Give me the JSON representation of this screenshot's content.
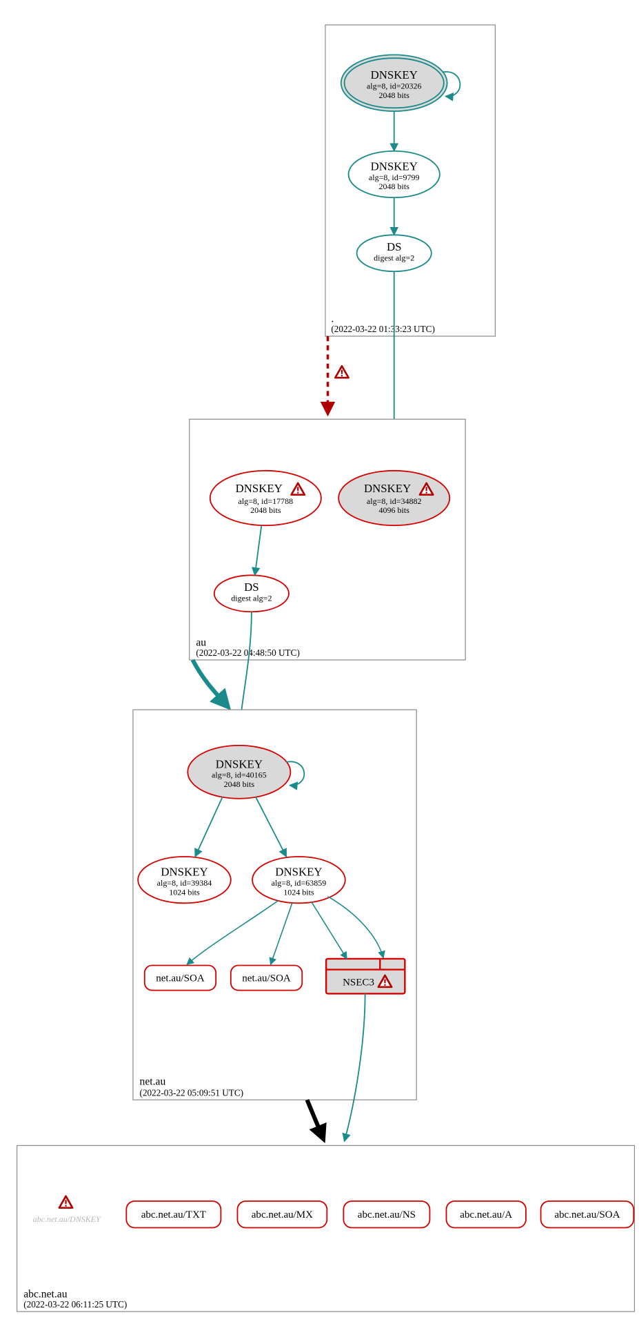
{
  "colors": {
    "teal": "#1a8a8a",
    "red": "#d40000",
    "darkred": "#b00000",
    "greyfill": "#d9d9d9",
    "lightgrey": "#f0f0f0",
    "boxstroke": "#8a8a8a",
    "faded": "#b8b8b8",
    "black": "#000000"
  },
  "zones": {
    "root": {
      "name": ".",
      "ts": "(2022-03-22 01:33:23 UTC)"
    },
    "au": {
      "name": "au",
      "ts": "(2022-03-22 04:48:50 UTC)"
    },
    "netau": {
      "name": "net.au",
      "ts": "(2022-03-22 05:09:51 UTC)"
    },
    "abc": {
      "name": "abc.net.au",
      "ts": "(2022-03-22 06:11:25 UTC)"
    }
  },
  "nodes": {
    "root_ksk": {
      "title": "DNSKEY",
      "l1": "alg=8, id=20326",
      "l2": "2048 bits"
    },
    "root_zsk": {
      "title": "DNSKEY",
      "l1": "alg=8, id=9799",
      "l2": "2048 bits"
    },
    "root_ds": {
      "title": "DS",
      "l1": "digest alg=2"
    },
    "au_k1": {
      "title": "DNSKEY",
      "l1": "alg=8, id=17788",
      "l2": "2048 bits"
    },
    "au_k2": {
      "title": "DNSKEY",
      "l1": "alg=8, id=34882",
      "l2": "4096 bits"
    },
    "au_ds": {
      "title": "DS",
      "l1": "digest alg=2"
    },
    "netau_ksk": {
      "title": "DNSKEY",
      "l1": "alg=8, id=40165",
      "l2": "2048 bits"
    },
    "netau_z1": {
      "title": "DNSKEY",
      "l1": "alg=8, id=39384",
      "l2": "1024 bits"
    },
    "netau_z2": {
      "title": "DNSKEY",
      "l1": "alg=8, id=63859",
      "l2": "1024 bits"
    },
    "netau_soa1": "net.au/SOA",
    "netau_soa2": "net.au/SOA",
    "nsec3": "NSEC3",
    "abc_dnskey_faded": "abc.net.au/DNSKEY",
    "abc_txt": "abc.net.au/TXT",
    "abc_mx": "abc.net.au/MX",
    "abc_ns": "abc.net.au/NS",
    "abc_a": "abc.net.au/A",
    "abc_soa": "abc.net.au/SOA"
  }
}
